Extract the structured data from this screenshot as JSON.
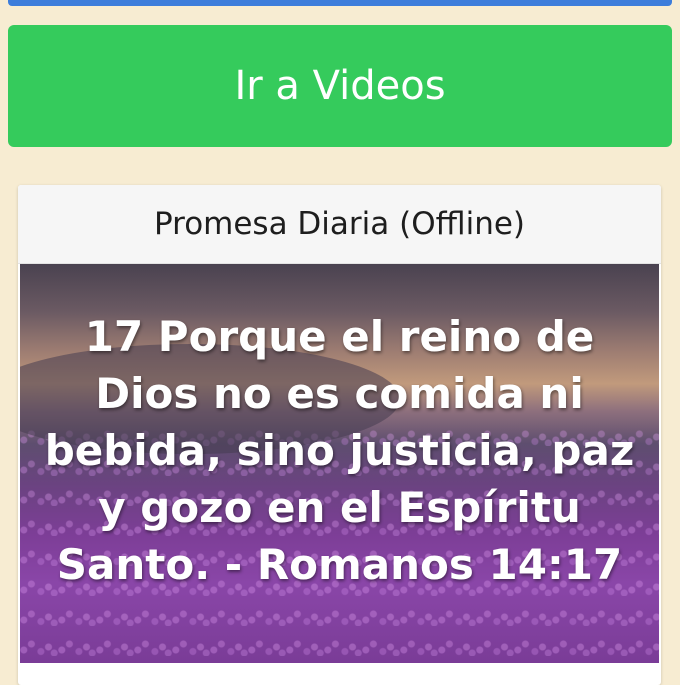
{
  "buttons": {
    "videos_label": "Ir a Videos"
  },
  "promise_card": {
    "title": "Promesa Diaria (Offline)",
    "verse_text": "17 Porque el reino de Dios no es comida ni bebida, sino justicia, paz y gozo en el Espíritu Santo. - Romanos 14:17"
  },
  "colors": {
    "page_background": "#f7ecd2",
    "videos_button": "#35cb5c",
    "top_button": "#3d7ddb",
    "card_header": "#f6f6f6"
  }
}
